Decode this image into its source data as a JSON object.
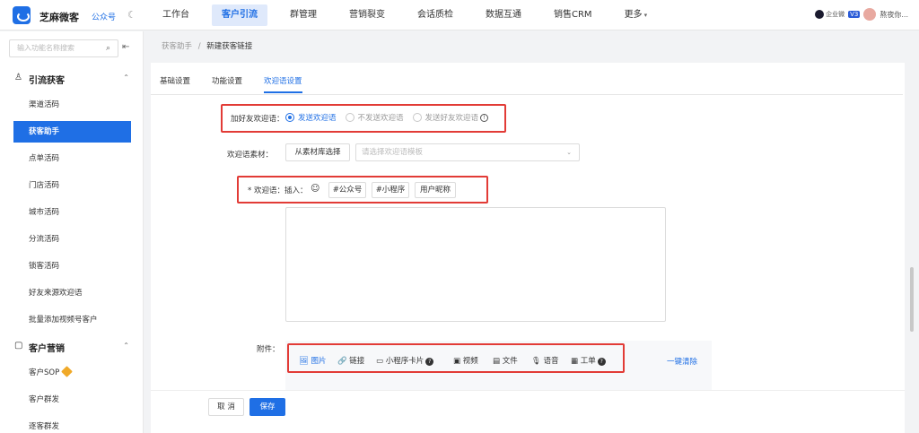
{
  "topbar": {
    "brand": "芝麻微客",
    "brand_sub": "公众号",
    "moon_icon": "☾",
    "nav": [
      "工作台",
      "客户引流",
      "群管理",
      "营销裂变",
      "会话质检",
      "数据互通",
      "销售CRM",
      "更多"
    ],
    "more_chevron": "▾",
    "wecom_badge": "企业微",
    "version": "V3",
    "user": "熬夜你..."
  },
  "sidebar": {
    "search_placeholder": "输入功能名称搜索",
    "search_icon": "⌕",
    "collapse_icon": "⇤",
    "group1": {
      "icon": "♙",
      "label": "引流获客",
      "chevron": "⌃"
    },
    "group1_items": [
      "渠道活码",
      "获客助手",
      "点单活码",
      "门店活码",
      "城市活码",
      "分流活码",
      "锁客活码",
      "好友来源欢迎语",
      "批量添加视频号客户"
    ],
    "group2": {
      "icon": "▢",
      "label": "客户营销",
      "chevron": "⌃"
    },
    "group2_items": [
      "客户SOP",
      "客户群发",
      "逐客群发"
    ]
  },
  "breadcrumb": {
    "parent": "获客助手",
    "sep": "/",
    "current": "新建获客链接"
  },
  "tabs": [
    "基础设置",
    "功能设置",
    "欢迎语设置"
  ],
  "form": {
    "welcome_toggle_label": "加好友欢迎语：",
    "radio_options": [
      "发送欢迎语",
      "不发送欢迎语",
      "发送好友欢迎语"
    ],
    "info_icon": "!",
    "material_label": "欢迎语素材：",
    "material_button": "从素材库选择",
    "template_placeholder": "请选择欢迎语模板",
    "template_chevron": "⌄",
    "welcome_label": "* 欢迎语：",
    "insert_label": "插入：",
    "emoji_icon": "☺",
    "insert_chips": [
      "#公众号",
      "#小程序",
      "用户昵称"
    ],
    "attachment_label": "附件：",
    "attachments": [
      {
        "icon": "🖼",
        "label": "图片"
      },
      {
        "icon": "🔗",
        "label": "链接"
      },
      {
        "icon": "▭",
        "label": "小程序卡片"
      },
      {
        "icon": "▣",
        "label": "视频"
      },
      {
        "icon": "▤",
        "label": "文件"
      },
      {
        "icon": "🎙",
        "label": "语音"
      },
      {
        "icon": "▦",
        "label": "工单"
      }
    ],
    "question_icon": "?",
    "clear_link": "一键清除"
  },
  "footer": {
    "cancel": "取 消",
    "save": "保存"
  }
}
